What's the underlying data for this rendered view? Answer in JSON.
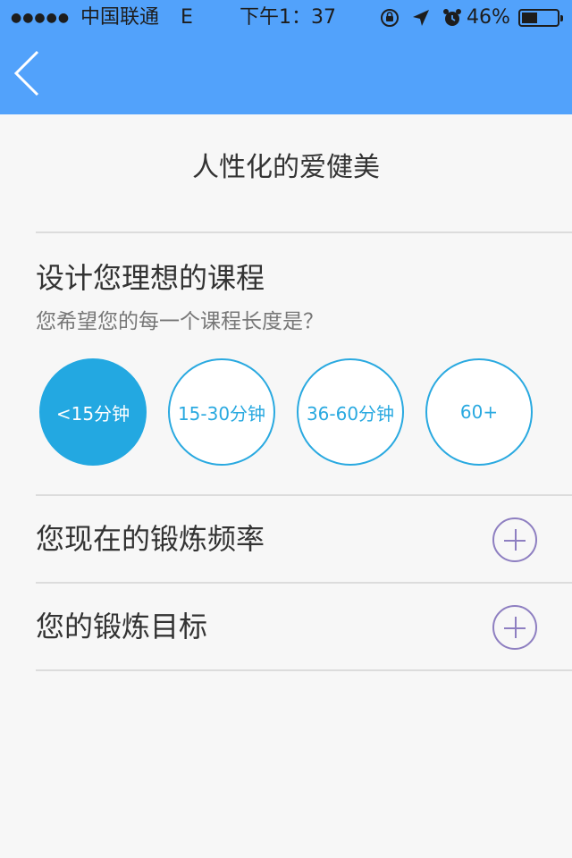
{
  "status_bar": {
    "signal": "●●●●●",
    "carrier": "中国联通",
    "network": "E",
    "time": "下午1：37",
    "icons": [
      "rotation-lock-icon",
      "location-arrow-icon",
      "alarm-clock-icon"
    ],
    "battery_percent": "46%",
    "battery_level": 0.46
  },
  "nav": {
    "back_icon": "chevron-left-icon"
  },
  "page": {
    "title": "人性化的爱健美"
  },
  "course_section": {
    "heading": "设计您理想的课程",
    "question": "您希望您的每一个课程长度是？",
    "options": [
      {
        "label": "<15分钟",
        "selected": true
      },
      {
        "label": "15-30分钟",
        "selected": false
      },
      {
        "label": "36-60分钟",
        "selected": false
      },
      {
        "label": "60+",
        "selected": false
      }
    ]
  },
  "frequency_row": {
    "label": "您现在的锻炼频率",
    "action_icon": "plus-circle-icon"
  },
  "goal_row": {
    "label": "您的锻炼目标",
    "action_icon": "plus-circle-icon"
  },
  "colors": {
    "header_bg": "#52a2fb",
    "accent": "#23a8e1",
    "plus_icon": "#8e7fc1",
    "page_bg": "#f7f7f7"
  }
}
